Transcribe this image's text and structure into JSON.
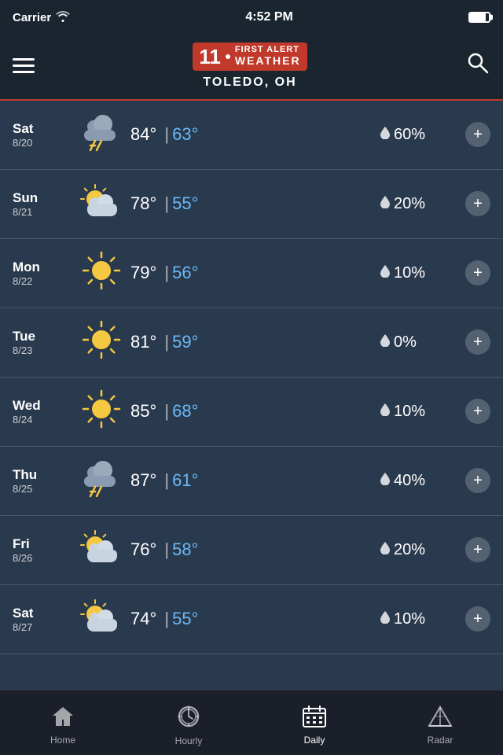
{
  "statusBar": {
    "carrier": "Carrier",
    "time": "4:52 PM"
  },
  "header": {
    "logoNum": "11",
    "firstAlert": "FIRST ALERT",
    "weatherText": "WEATHER",
    "city": "TOLEDO, OH"
  },
  "forecast": [
    {
      "day": "Sat",
      "date": "8/20",
      "icon": "storm-cloud",
      "high": "84°",
      "sep": "|",
      "low": "63°",
      "precip": "60%"
    },
    {
      "day": "Sun",
      "date": "8/21",
      "icon": "partly-cloudy",
      "high": "78°",
      "sep": "|",
      "low": "55°",
      "precip": "20%"
    },
    {
      "day": "Mon",
      "date": "8/22",
      "icon": "sunny",
      "high": "79°",
      "sep": "|",
      "low": "56°",
      "precip": "10%"
    },
    {
      "day": "Tue",
      "date": "8/23",
      "icon": "sunny",
      "high": "81°",
      "sep": "|",
      "low": "59°",
      "precip": "0%"
    },
    {
      "day": "Wed",
      "date": "8/24",
      "icon": "sunny",
      "high": "85°",
      "sep": "|",
      "low": "68°",
      "precip": "10%"
    },
    {
      "day": "Thu",
      "date": "8/25",
      "icon": "storm-cloud",
      "high": "87°",
      "sep": "|",
      "low": "61°",
      "precip": "40%"
    },
    {
      "day": "Fri",
      "date": "8/26",
      "icon": "partly-cloudy",
      "high": "76°",
      "sep": "|",
      "low": "58°",
      "precip": "20%"
    },
    {
      "day": "Sat",
      "date": "8/27",
      "icon": "partly-cloudy",
      "high": "74°",
      "sep": "|",
      "low": "55°",
      "precip": "10%"
    }
  ],
  "tabs": [
    {
      "id": "home",
      "label": "Home",
      "active": false
    },
    {
      "id": "hourly",
      "label": "Hourly",
      "active": false
    },
    {
      "id": "daily",
      "label": "Daily",
      "active": true
    },
    {
      "id": "radar",
      "label": "Radar",
      "active": false
    }
  ]
}
